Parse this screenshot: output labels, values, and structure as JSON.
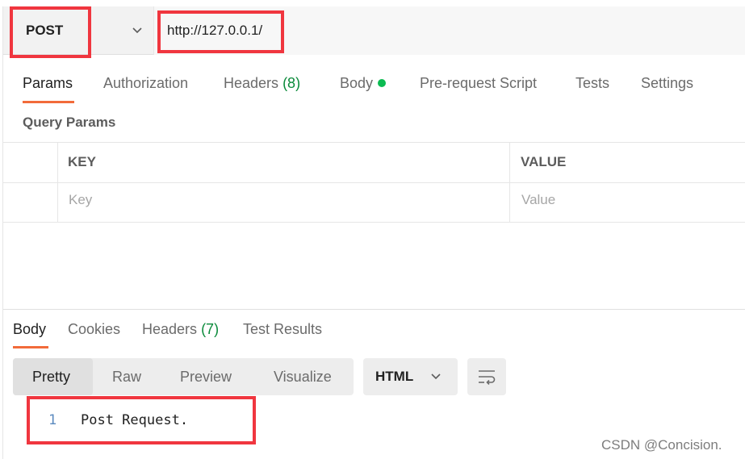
{
  "request": {
    "method": "POST",
    "url": "http://127.0.0.1/"
  },
  "request_tabs": [
    {
      "label": "Params",
      "active": true
    },
    {
      "label": "Authorization"
    },
    {
      "label": "Headers",
      "count": "(8)"
    },
    {
      "label": "Body",
      "indicator": "green-dot"
    },
    {
      "label": "Pre-request Script"
    },
    {
      "label": "Tests"
    },
    {
      "label": "Settings"
    }
  ],
  "params": {
    "title": "Query Params",
    "columns": [
      "KEY",
      "VALUE"
    ],
    "key_placeholder": "Key",
    "value_placeholder": "Value"
  },
  "response_tabs": [
    {
      "label": "Body",
      "active": true
    },
    {
      "label": "Cookies"
    },
    {
      "label": "Headers",
      "count": "(7)"
    },
    {
      "label": "Test Results"
    }
  ],
  "view_modes": [
    "Pretty",
    "Raw",
    "Preview",
    "Visualize"
  ],
  "active_view_mode": "Pretty",
  "format": "HTML",
  "response_body": {
    "line_number": "1",
    "text": "Post Request."
  },
  "watermark": "CSDN @Concision.",
  "icons": {
    "method_dropdown": "chevron-down-icon",
    "format_dropdown": "chevron-down-icon",
    "wrap_lines": "wrap-lines-icon",
    "body_status": "green-dot-icon"
  },
  "colors": {
    "accent": "#f26b3a",
    "highlight": "#f0363f",
    "count_green": "#0a8a3a",
    "status_dot": "#0cbb52"
  }
}
